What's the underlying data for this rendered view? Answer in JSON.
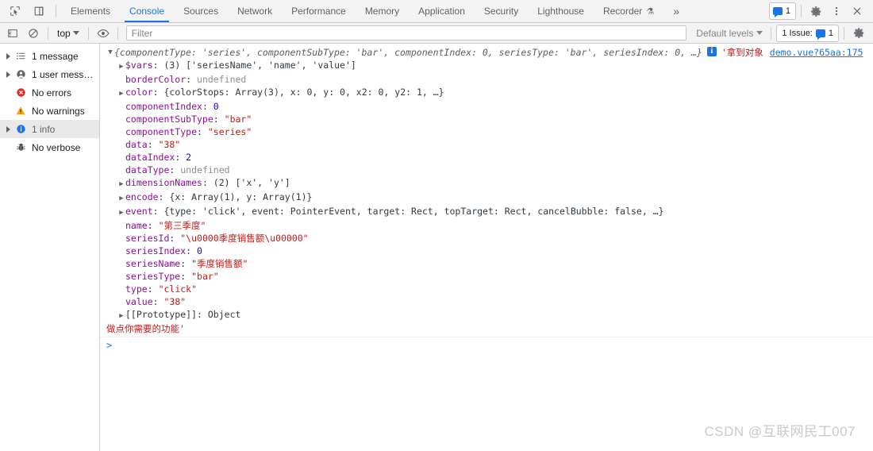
{
  "tabbar": {
    "tabs": [
      {
        "label": "Elements",
        "active": false,
        "flask": false
      },
      {
        "label": "Console",
        "active": true,
        "flask": false
      },
      {
        "label": "Sources",
        "active": false,
        "flask": false
      },
      {
        "label": "Network",
        "active": false,
        "flask": false
      },
      {
        "label": "Performance",
        "active": false,
        "flask": false
      },
      {
        "label": "Memory",
        "active": false,
        "flask": false
      },
      {
        "label": "Application",
        "active": false,
        "flask": false
      },
      {
        "label": "Security",
        "active": false,
        "flask": false
      },
      {
        "label": "Lighthouse",
        "active": false,
        "flask": false
      },
      {
        "label": "Recorder",
        "active": false,
        "flask": true
      }
    ],
    "more_label": "»",
    "issue_count": "1",
    "icons": {
      "inspect": "inspect-element-icon",
      "device": "device-toolbar-icon",
      "issues": "issues-badge-icon",
      "settings": "gear-icon",
      "more": "kebab-menu-icon",
      "close": "close-icon"
    }
  },
  "console_toolbar": {
    "clear_label": "clear-console",
    "sidebar_label": "console-sidebar",
    "context": "top",
    "eye_label": "live-expression",
    "filter_placeholder": "Filter",
    "filter_value": "",
    "levels_label": "Default levels",
    "issues_label": "1 Issue:",
    "issues_count": "1",
    "settings_label": "console-settings"
  },
  "sidebar": {
    "items": [
      {
        "label": "1 message",
        "icon": "list-icon",
        "expandable": true,
        "selected": false
      },
      {
        "label": "1 user mess…",
        "icon": "user-icon",
        "expandable": true,
        "selected": false
      },
      {
        "label": "No errors",
        "icon": "error-icon",
        "expandable": false,
        "selected": false
      },
      {
        "label": "No warnings",
        "icon": "warning-icon",
        "expandable": false,
        "selected": false
      },
      {
        "label": "1 info",
        "icon": "info-icon",
        "expandable": true,
        "selected": true
      },
      {
        "label": "No verbose",
        "icon": "bug-icon",
        "expandable": false,
        "selected": false
      }
    ]
  },
  "console": {
    "header": {
      "toggle": "▼",
      "preview_open": "{",
      "parts": [
        {
          "t": "componentType: ",
          "c": "italic"
        },
        {
          "t": "'series'",
          "c": "italic-str"
        },
        {
          "t": ", componentSubType: ",
          "c": "italic"
        },
        {
          "t": "'bar'",
          "c": "italic-str"
        },
        {
          "t": ", componentIndex: ",
          "c": "italic"
        },
        {
          "t": "0",
          "c": "italic-num"
        },
        {
          "t": ", seriesType: ",
          "c": "italic"
        },
        {
          "t": "'bar'",
          "c": "italic-str"
        },
        {
          "t": ", seriesIndex: ",
          "c": "italic"
        },
        {
          "t": "0",
          "c": "italic-num"
        },
        {
          "t": ", …}",
          "c": "italic"
        }
      ],
      "full_text": "{componentType: 'series', componentSubType: 'bar', componentIndex: 0, seriesType: 'bar', seriesIndex: 0, …}",
      "annotation": "'拿到对象",
      "source": "demo.vue?65aa:175"
    },
    "properties": [
      {
        "arrow": true,
        "key": "$vars",
        "sep": ": ",
        "value": "(3) ['seriesName', 'name', 'value']",
        "vtype": "array"
      },
      {
        "arrow": false,
        "key": "borderColor",
        "sep": ": ",
        "value": "undefined",
        "vtype": "undefined"
      },
      {
        "arrow": true,
        "key": "color",
        "sep": ": ",
        "value": "{colorStops: Array(3), x: 0, y: 0, x2: 0, y2: 1, …}",
        "vtype": "object"
      },
      {
        "arrow": false,
        "key": "componentIndex",
        "sep": ": ",
        "value": "0",
        "vtype": "number"
      },
      {
        "arrow": false,
        "key": "componentSubType",
        "sep": ": ",
        "value": "\"bar\"",
        "vtype": "string"
      },
      {
        "arrow": false,
        "key": "componentType",
        "sep": ": ",
        "value": "\"series\"",
        "vtype": "string"
      },
      {
        "arrow": false,
        "key": "data",
        "sep": ": ",
        "value": "\"38\"",
        "vtype": "string"
      },
      {
        "arrow": false,
        "key": "dataIndex",
        "sep": ": ",
        "value": "2",
        "vtype": "number"
      },
      {
        "arrow": false,
        "key": "dataType",
        "sep": ": ",
        "value": "undefined",
        "vtype": "undefined"
      },
      {
        "arrow": true,
        "key": "dimensionNames",
        "sep": ": ",
        "value": "(2) ['x', 'y']",
        "vtype": "array"
      },
      {
        "arrow": true,
        "key": "encode",
        "sep": ": ",
        "value": "{x: Array(1), y: Array(1)}",
        "vtype": "object"
      },
      {
        "arrow": true,
        "key": "event",
        "sep": ": ",
        "value": "{type: 'click', event: PointerEvent, target: Rect, topTarget: Rect, cancelBubble: false, …}",
        "vtype": "object"
      },
      {
        "arrow": false,
        "key": "name",
        "sep": ": ",
        "value": "\"第三季度\"",
        "vtype": "string"
      },
      {
        "arrow": false,
        "key": "seriesId",
        "sep": ": ",
        "value": "\"\\u0000季度销售额\\u00000\"",
        "vtype": "string"
      },
      {
        "arrow": false,
        "key": "seriesIndex",
        "sep": ": ",
        "value": "0",
        "vtype": "number"
      },
      {
        "arrow": false,
        "key": "seriesName",
        "sep": ": ",
        "value": "\"季度销售额\"",
        "vtype": "string"
      },
      {
        "arrow": false,
        "key": "seriesType",
        "sep": ": ",
        "value": "\"bar\"",
        "vtype": "string"
      },
      {
        "arrow": false,
        "key": "type",
        "sep": ": ",
        "value": "\"click\"",
        "vtype": "string"
      },
      {
        "arrow": false,
        "key": "value",
        "sep": ": ",
        "value": "\"38\"",
        "vtype": "string"
      },
      {
        "arrow": true,
        "key": "[[Prototype]]",
        "sep": ": ",
        "value": "Object",
        "vtype": "proto"
      }
    ],
    "trailing_text": "做点你需要的功能'",
    "prompt_symbol": ">",
    "prompt_value": ""
  },
  "watermark": "CSDN @互联网民工007",
  "colors": {
    "accent": "#1a73e8",
    "string": "#c41a16",
    "property": "#881391",
    "number": "#1c00cf",
    "undefined": "#8d8d8d",
    "toolbar_bg": "#f3f3f3",
    "selected_row": "#e8e8e8",
    "error": "#d93025",
    "warning": "#f9ab00"
  }
}
